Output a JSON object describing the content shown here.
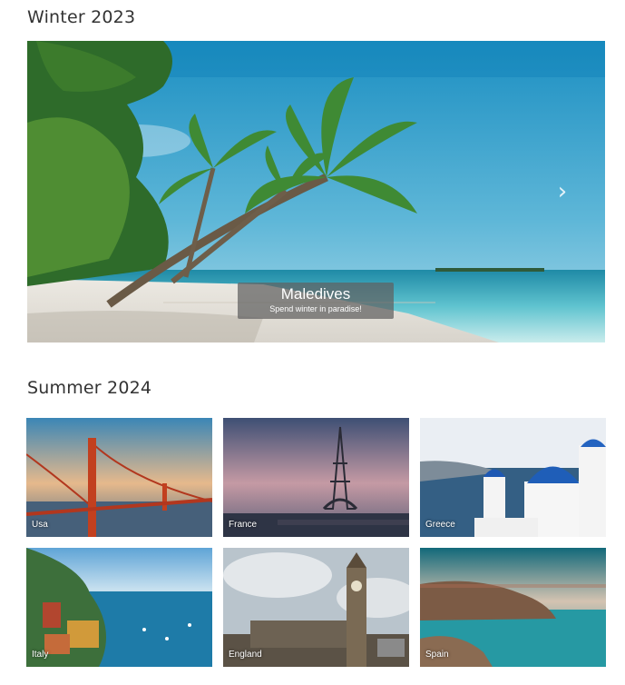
{
  "winter": {
    "title": "Winter 2023",
    "slide": {
      "title": "Maledives",
      "subtitle": "Spend winter in paradise!"
    },
    "next_icon": "chevron-right-icon"
  },
  "summer": {
    "title": "Summer 2024",
    "destinations": [
      {
        "label": "Usa"
      },
      {
        "label": "France"
      },
      {
        "label": "Greece"
      },
      {
        "label": "Italy"
      },
      {
        "label": "England"
      },
      {
        "label": "Spain"
      }
    ]
  }
}
